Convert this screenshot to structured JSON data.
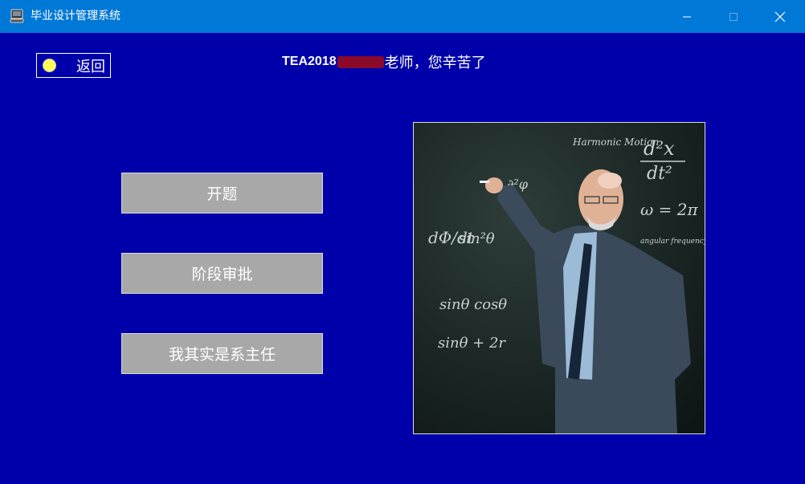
{
  "window": {
    "title": "毕业设计管理系统",
    "min_glyph": "—",
    "max_glyph": "□",
    "close_glyph": "✕",
    "app_icon": "computer-icon"
  },
  "colors": {
    "titlebar": "#0078D7",
    "background": "#0000AA",
    "button_fill": "#A8A8A8",
    "redaction": "#8b0a2a"
  },
  "back": {
    "label": "返回",
    "icon": "yellow-circle-icon"
  },
  "greeting": {
    "id_prefix": "TEA2018",
    "suffix": "老师，您辛苦了"
  },
  "menu": [
    {
      "label": "开题"
    },
    {
      "label": "阶段审批"
    },
    {
      "label": "我其实是系主任"
    }
  ],
  "photo": {
    "subject": "teacher-at-chalkboard",
    "chalk_1": "Harmonic Motion",
    "chalk_2": "d²x",
    "chalk_3": "dt²",
    "chalk_4": "ω = 2π",
    "chalk_5": "angular frequency",
    "chalk_6": "dΦ/dt",
    "chalk_7": "sin²θ",
    "chalk_8": "sinθ cosθ",
    "chalk_9": "sinθ + 2r",
    "chalk_10": "∂²φ"
  }
}
